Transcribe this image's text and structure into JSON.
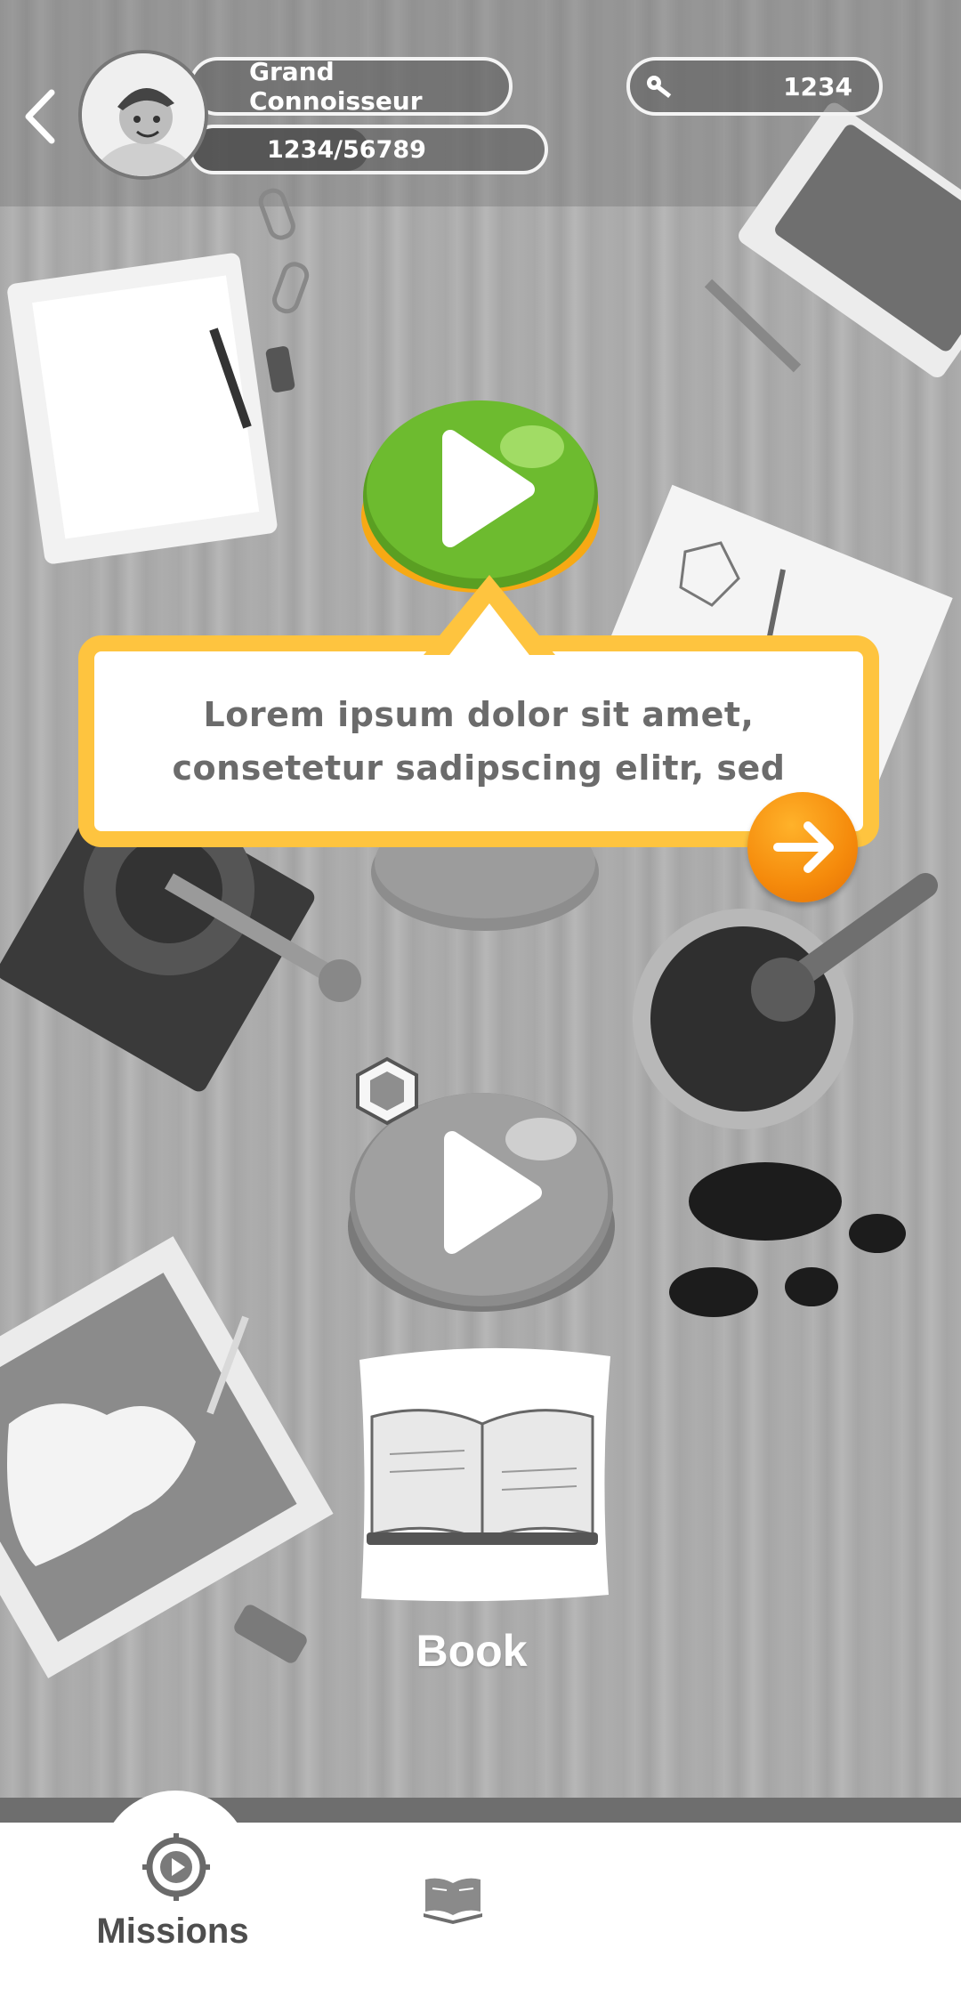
{
  "header": {
    "player_title": "Grand Connoisseur",
    "xp_text": "1234/56789",
    "xp_progress": 0.5,
    "keys_count": "1234"
  },
  "tooltip": {
    "line1": "Lorem ipsum dolor sit amet,",
    "line2": "consetetur sadipscing elitr, sed"
  },
  "book_card": {
    "label": "Book"
  },
  "bottom_nav": {
    "tabs": [
      {
        "label": "Missions",
        "icon": "compass-play-icon",
        "active": true
      },
      {
        "label": "",
        "icon": "open-book-icon",
        "active": false
      }
    ]
  },
  "colors": {
    "accent_orange": "#f58a0b",
    "tooltip_border": "#fec43f",
    "play_green": "#6dbb2f"
  }
}
